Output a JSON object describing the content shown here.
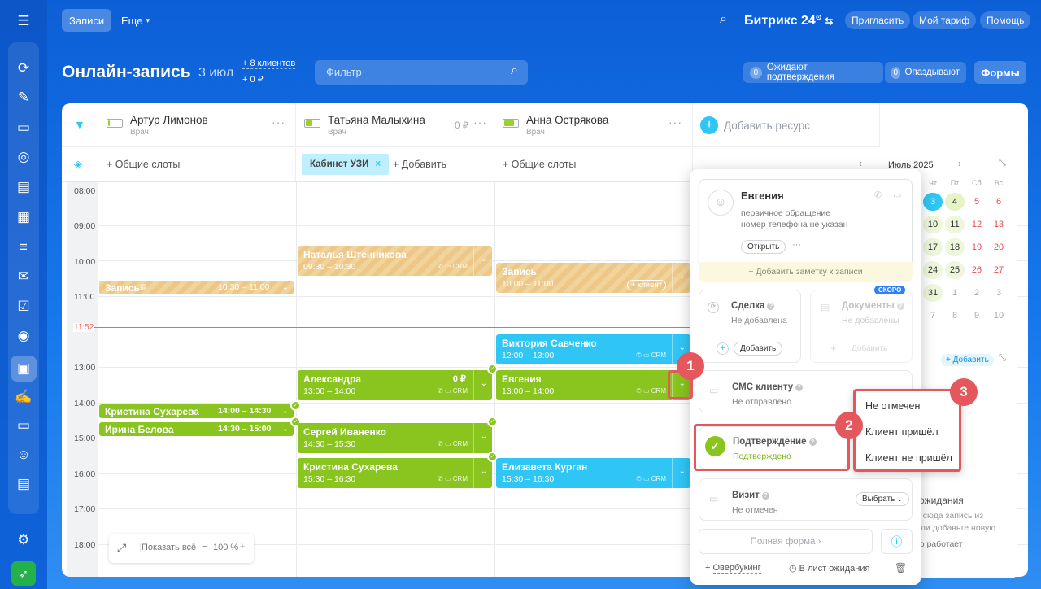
{
  "topbar": {
    "tab_active": "Записи",
    "tab_more": "Еще",
    "brand": "Битрикс 24",
    "invite": "Пригласить",
    "plan": "Мой тариф",
    "help": "Помощь"
  },
  "header": {
    "title": "Онлайн-запись",
    "date": "3 июл",
    "plus_clients": "+ 8 клиентов",
    "plus_money": "+ 0 ₽",
    "filter_placeholder": "Фильтр",
    "awaiting": "Ожидают подтверждения",
    "awaiting_count": "0",
    "late": "Опаздывают",
    "late_count": "0",
    "forms": "Формы"
  },
  "resources": [
    {
      "name": "Артур Лимонов",
      "role": "Врач",
      "slots": "+ Общие слоты"
    },
    {
      "name": "Татьяна Малыхина",
      "role": "Врач",
      "amount": "0 ₽",
      "chip": "Кабинет УЗИ",
      "add": "+ Добавить"
    },
    {
      "name": "Анна Острякова",
      "role": "Врач",
      "slots": "+ Общие слоты"
    }
  ],
  "add_resource": "Добавить ресурс",
  "hours": [
    "08:00",
    "09:00",
    "10:00",
    "11:00",
    "13:00",
    "14:00",
    "15:00",
    "16:00",
    "17:00",
    "18:00"
  ],
  "now": "11:52",
  "events": {
    "e1": {
      "name": "Запись",
      "time": "10:30 – 11:00"
    },
    "e2": {
      "name": "Кристина Сухарева",
      "time": "14:00 – 14:30"
    },
    "e3": {
      "name": "Ирина Белова",
      "time": "14:30 – 15:00"
    },
    "e4": {
      "name": "Наталья Штенникова",
      "time": "09:30 – 10:30"
    },
    "e5": {
      "name": "Александра",
      "time": "13:00 – 14:00",
      "amount": "0 ₽"
    },
    "e6": {
      "name": "Сергей Иваненко",
      "time": "14:30 – 15:30"
    },
    "e7": {
      "name": "Кристина Сухарева",
      "time": "15:30 – 16:30"
    },
    "e8": {
      "name": "Запись",
      "time": "10:00 – 11:00",
      "client": "+ клиент"
    },
    "e9": {
      "name": "Виктория Савченко",
      "time": "12:00 – 13:00"
    },
    "e10": {
      "name": "Евгения",
      "time": "13:00 – 14:00"
    },
    "e11": {
      "name": "Елизавета Курган",
      "time": "15:30 – 16:30"
    },
    "crm": "CRM"
  },
  "popup": {
    "client_name": "Евгения",
    "line1": "первичное обращение",
    "line2": "номер телефона не указан",
    "open": "Открыть",
    "add_note": "+ Добавить заметку к записи",
    "deal": "Сделка",
    "deal_status": "Не добавлена",
    "deal_add": "Добавить",
    "docs": "Документы",
    "docs_status": "Не добавлены",
    "docs_add": "Добавить",
    "soon": "СКОРО",
    "sms": "СМС клиенту",
    "sms_status": "Не отправлено",
    "confirm": "Подтверждение",
    "confirm_status": "Подтверждено",
    "visit": "Визит",
    "visit_status": "Не отмечен",
    "choose": "Выбрать",
    "full_form": "Полная форма",
    "overbooking": "Овербукинг",
    "waitlist": "В лист ожидания"
  },
  "dropdown": [
    "Не отмечен",
    "Клиент пришёл",
    "Клиент не пришёл"
  ],
  "badges": [
    "1",
    "2",
    "3"
  ],
  "calendar": {
    "month": "Июль 2025",
    "weekdays": [
      "Чт",
      "Пт",
      "Сб",
      "Вс"
    ],
    "rows": [
      [
        "3",
        "4",
        "5",
        "6"
      ],
      [
        "10",
        "11",
        "12",
        "13"
      ],
      [
        "17",
        "18",
        "19",
        "20"
      ],
      [
        "24",
        "25",
        "26",
        "27"
      ],
      [
        "31",
        "1",
        "2",
        "3"
      ],
      [
        "7",
        "8",
        "9",
        "10"
      ]
    ]
  },
  "waitlist": {
    "add": "+ Добавить",
    "title": "ожидания",
    "text1": "е сюда запись из",
    "text2": "или добавьте новую",
    "text3": "то работает"
  },
  "bottom": {
    "show_all": "Показать всё",
    "zoom": "100 %"
  }
}
